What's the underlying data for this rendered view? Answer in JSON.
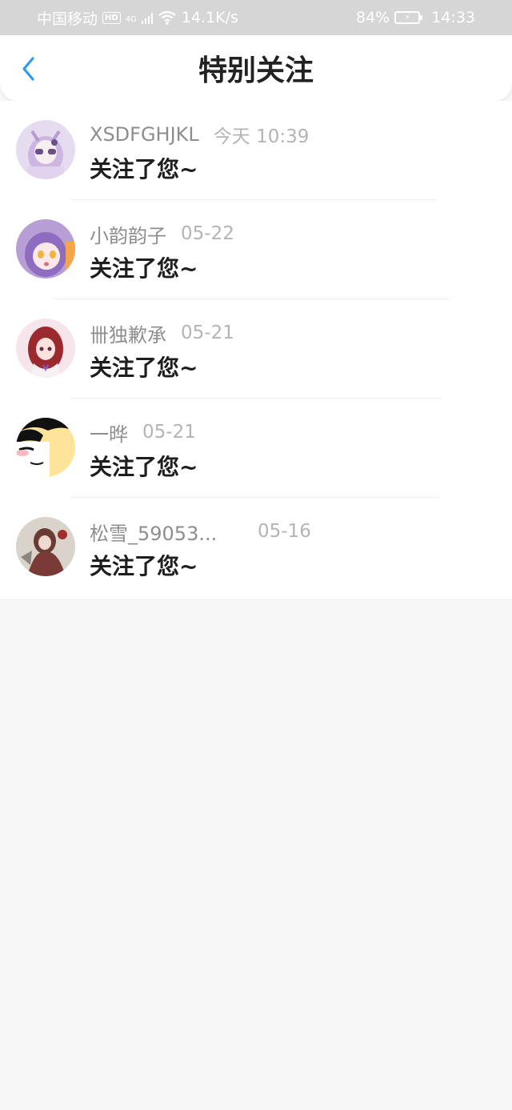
{
  "status_bar": {
    "carrier": "中国移动",
    "hd": "HD",
    "net_type": "4G",
    "speed": "14.1K/s",
    "battery": "84%",
    "time": "14:33"
  },
  "header": {
    "title": "特别关注",
    "back_icon": "chevron-left-icon",
    "accent": "#2e9bf0"
  },
  "list": {
    "items": [
      {
        "name": "XSDFGHJKL",
        "time": "今天 10:39",
        "message": "关注了您~"
      },
      {
        "name": "小韵韵子",
        "time": "05-22",
        "message": "关注了您~"
      },
      {
        "name": "卌独歉承",
        "time": "05-21",
        "message": "关注了您~"
      },
      {
        "name": "一晔",
        "time": "05-21",
        "message": "关注了您~"
      },
      {
        "name": "松雪_59053...",
        "time": "05-16",
        "message": "关注了您~"
      }
    ]
  }
}
